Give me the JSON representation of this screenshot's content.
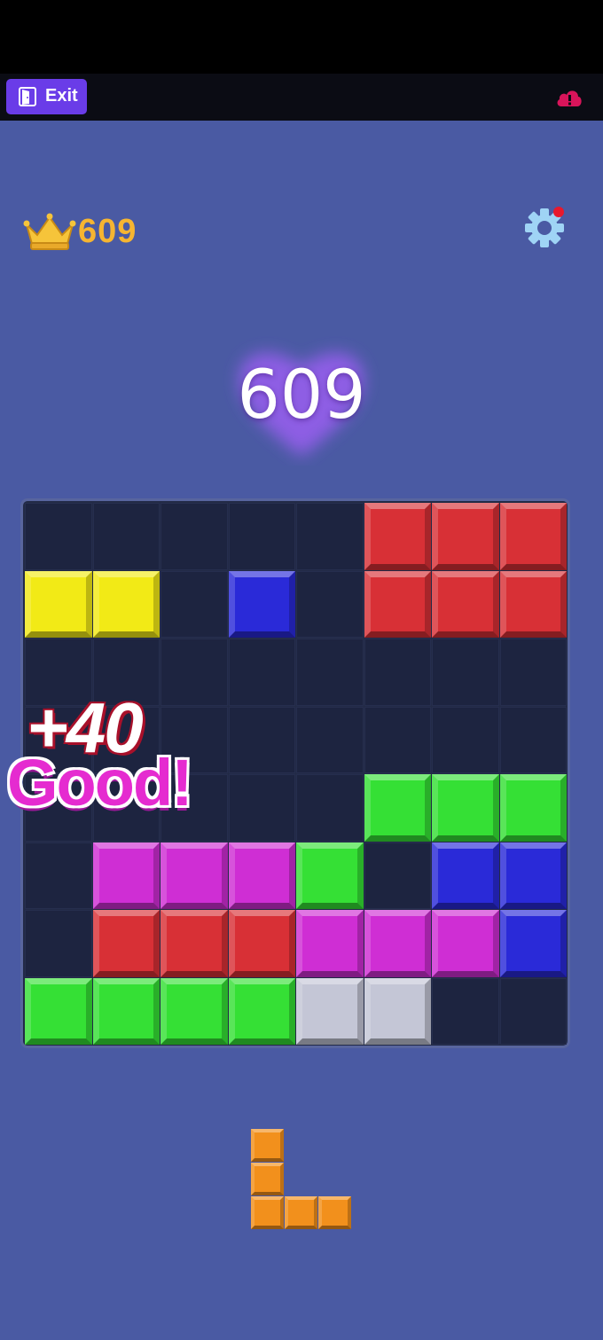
{
  "topbar": {
    "exit_label": "Exit"
  },
  "header": {
    "best_score": "609",
    "current_score": "609"
  },
  "popup": {
    "points": "+40",
    "praise": "Good!"
  },
  "colors": {
    "R": "#d83036",
    "Y": "#f2ea16",
    "B": "#2a2ad8",
    "G": "#35e035",
    "M": "#cf2ed4",
    "W": "#c4c6d6",
    "O": "#f2901c",
    "background": "#4a5aa3",
    "accent": "#6a3ce8",
    "score_gold": "#f6b531"
  },
  "board": {
    "rows": [
      ".....RRR",
      "YY.B.RRR",
      "........",
      "........",
      ".....GGG",
      ".MMMG.BB",
      ".RRRMMMB",
      "GGGGWW.."
    ]
  },
  "tray": {
    "pieces": [
      {
        "color": "O",
        "shape": [
          "X..",
          "X..",
          "XXX"
        ]
      }
    ]
  },
  "icons": [
    "exit-door-icon",
    "cloud-alert-icon",
    "crown-icon",
    "gear-icon",
    "heart-glow-icon"
  ]
}
